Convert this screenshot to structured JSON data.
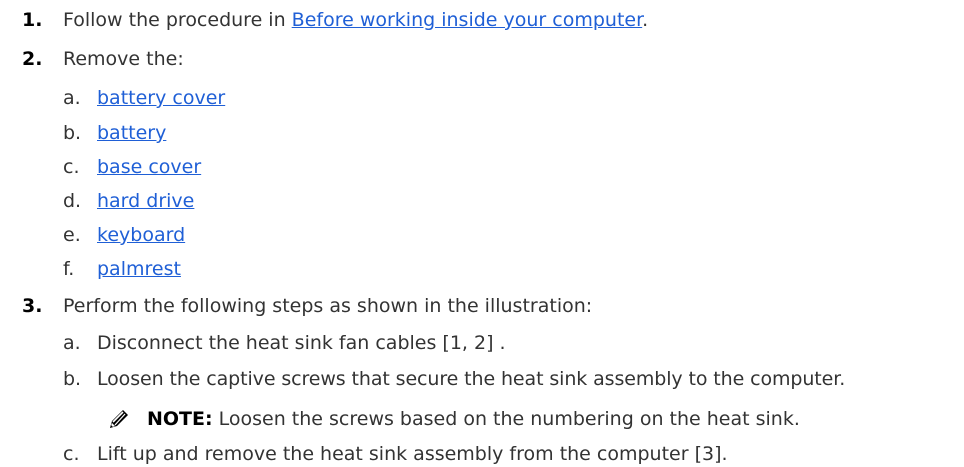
{
  "steps": [
    {
      "number": "1.",
      "text_before": "Follow the procedure in ",
      "link": "Before working inside your computer",
      "text_after": "."
    },
    {
      "number": "2.",
      "text": "Remove the:",
      "items": [
        {
          "letter": "a.",
          "link": "battery cover"
        },
        {
          "letter": "b.",
          "link": "battery"
        },
        {
          "letter": "c.",
          "link": "base cover"
        },
        {
          "letter": "d.",
          "link": "hard drive"
        },
        {
          "letter": "e.",
          "link": "keyboard"
        },
        {
          "letter": "f.",
          "link": "palmrest"
        }
      ]
    },
    {
      "number": "3.",
      "text": "Perform the following steps as shown in the illustration:",
      "substeps": [
        {
          "letter": "a.",
          "text": "Disconnect the heat sink fan cables [1, 2] ."
        },
        {
          "letter": "b.",
          "text": "Loosen the captive screws that secure the heat sink assembly to the computer."
        },
        {
          "letter": "c.",
          "text": "Lift up and remove the heat sink assembly from the computer [3]."
        }
      ],
      "note": {
        "label": "NOTE:",
        "text": " Loosen the screws based on the numbering on the heat sink.",
        "icon": "pencil-icon"
      }
    }
  ],
  "colors": {
    "link": "#1f5fd6",
    "text": "#333333"
  }
}
